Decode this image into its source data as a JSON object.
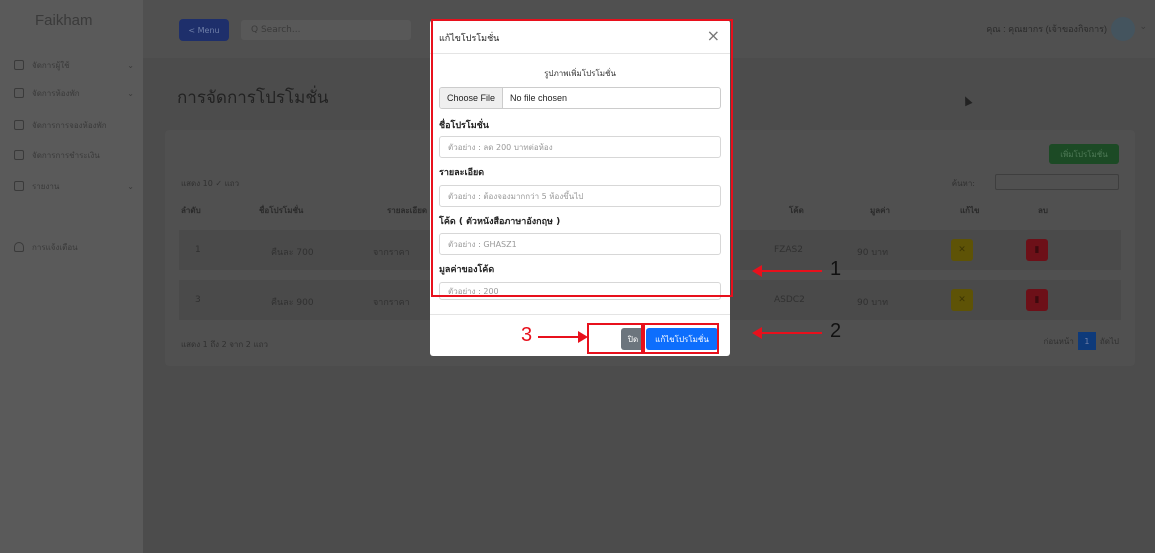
{
  "sidebar": {
    "brand": "Faikham",
    "items": [
      {
        "label": "จัดการผู้ใช้",
        "has_chevron": true
      },
      {
        "label": "จัดการห้องพัก",
        "has_chevron": true
      },
      {
        "label": "จัดการการจองห้องพัก",
        "has_chevron": false
      },
      {
        "label": "จัดการการชำระเงิน",
        "has_chevron": false
      },
      {
        "label": "รายงาน",
        "has_chevron": true
      },
      {
        "label": "การแจ้งเตือน",
        "has_chevron": false
      }
    ]
  },
  "topbar": {
    "menu_label": "< Menu",
    "search_placeholder": "Q Search...",
    "user_label": "คุณ : คุณยากร (เจ้าของกิจการ)"
  },
  "main": {
    "title": "การจัดการโปรโมชั่น",
    "add_button": "เพิ่มโปรโมชั่น",
    "show_label": "แสดง 10 ✓ แถว",
    "search_label": "ค้นหา:",
    "columns": [
      "ลำดับ",
      "ชื่อโปรโมชั่น",
      "รายละเอียด",
      "โค้ด",
      "มูลค่า",
      "แก้ไข",
      "ลบ"
    ],
    "rows": [
      {
        "index": "1",
        "name": "คืนละ 700",
        "detail": "จากราคา",
        "code": "FZAS2",
        "value": "90 บาท"
      },
      {
        "index": "3",
        "name": "คืนละ 900",
        "detail": "จากราคา",
        "code": "ASDC2",
        "value": "90 บาท"
      }
    ],
    "footer_info": "แสดง 1 ถึง 2 จาก 2 แถว",
    "pager": {
      "prev": "ก่อนหน้า",
      "page": "1",
      "next": "ถัดไป"
    }
  },
  "modal": {
    "title": "แก้ไขโปรโมชั่น",
    "image_label": "รูปภาพเพิ่มโปรโมชั่น",
    "file_button": "Choose File",
    "file_status": "No file chosen",
    "fields": [
      {
        "label": "ชื่อโปรโมชั่น",
        "placeholder": "ตัวอย่าง : ลด 200 บาทต่อห้อง"
      },
      {
        "label": "รายละเอียด",
        "placeholder": "ตัวอย่าง : ต้องจองมากกว่า 5 ห้องขึ้นไป"
      },
      {
        "label": "โค้ด ( ตัวหนังสือภาษาอังกฤษ )",
        "placeholder": "ตัวอย่าง : GHASZ1"
      },
      {
        "label": "มูลค่าของโค้ด",
        "placeholder": "ตัวอย่าง : 200"
      }
    ],
    "close_button": "ปิด",
    "save_button": "แก้ไขโปรโมชั่น"
  },
  "annotations": {
    "one": "1",
    "two": "2",
    "three": "3"
  },
  "colors": {
    "highlight": "#e8101c",
    "primary": "#0d6efd",
    "secondary": "#6c757d"
  }
}
